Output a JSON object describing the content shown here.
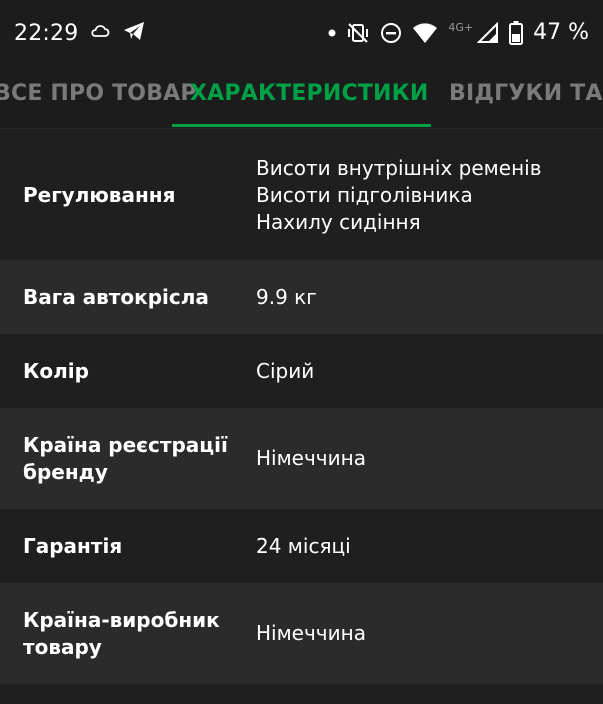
{
  "status_bar": {
    "time": "22:29",
    "network_label": "4G+",
    "battery_percent": "47 %",
    "icons": [
      "cloud-icon",
      "telegram-icon",
      "notification-dot-icon",
      "vibrate-icon",
      "do-not-disturb-icon",
      "wifi-icon",
      "signal-icon",
      "battery-icon"
    ]
  },
  "tabs": [
    {
      "label": "ВСЕ ПРО ТОВАР",
      "active": false
    },
    {
      "label": "ХАРАКТЕРИСТИКИ",
      "active": true
    },
    {
      "label": "ВІДГУКИ ТА ПИТАННЯ",
      "active": false
    }
  ],
  "colors": {
    "accent": "#00a046",
    "background": "#1f1f1f",
    "row_alt": "#2b2b2b",
    "inactive_tab": "#7a7a7a"
  },
  "specs": [
    {
      "name": "Регулювання",
      "values": [
        "Висоти внутрішніх ременів",
        "Висоти підголівника",
        "Нахилу сидіння"
      ]
    },
    {
      "name": "Вага автокрісла",
      "values": [
        "9.9 кг"
      ]
    },
    {
      "name": "Колір",
      "values": [
        "Сірий"
      ]
    },
    {
      "name": "Країна реєстрації бренду",
      "values": [
        "Німеччина"
      ]
    },
    {
      "name": "Гарантія",
      "values": [
        "24 місяці"
      ]
    },
    {
      "name": "Країна-виробник товару",
      "values": [
        "Німеччина"
      ]
    }
  ]
}
